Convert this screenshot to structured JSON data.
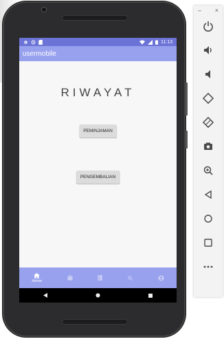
{
  "status_bar": {
    "time": "11:13"
  },
  "app_bar": {
    "title": "usermobile"
  },
  "main": {
    "heading": "RIWAYAT",
    "peminjaman_label": "PEMINJAMAN",
    "pengembalian_label": "PENGEMBALIAN"
  },
  "bottom_nav": {
    "items": [
      {
        "label": "Home",
        "icon": "home-icon",
        "active": true
      },
      {
        "label": "",
        "icon": "briefcase-icon",
        "active": false
      },
      {
        "label": "",
        "icon": "book-icon",
        "active": false
      },
      {
        "label": "",
        "icon": "search-icon",
        "active": false
      },
      {
        "label": "",
        "icon": "account-icon",
        "active": false
      }
    ]
  },
  "emulator_toolbar": {
    "minimize": "–",
    "close": "×",
    "items": [
      "power-icon",
      "volume-up-icon",
      "volume-down-icon",
      "rotate-left-icon",
      "rotate-right-icon",
      "camera-icon",
      "zoom-icon",
      "back-icon",
      "home-circle-icon",
      "overview-icon",
      "more-icon"
    ]
  },
  "colors": {
    "status_bar": "#6b73d6",
    "app_bar": "#98a1ee",
    "phone_frame": "#2c2c2e"
  }
}
